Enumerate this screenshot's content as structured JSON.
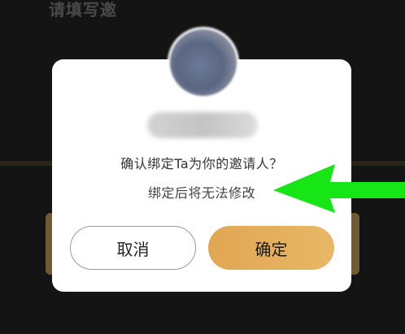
{
  "background": {
    "title_text": "请填写邀"
  },
  "dialog": {
    "message_line1": "确认绑定Ta为你的邀请人？",
    "message_line2": "绑定后将无法修改",
    "cancel_label": "取消",
    "confirm_label": "确定"
  },
  "colors": {
    "accent_gold": "#e4ad5c",
    "annotation_arrow": "#16e616"
  },
  "icons": {
    "annotation": "arrow-left-icon"
  }
}
